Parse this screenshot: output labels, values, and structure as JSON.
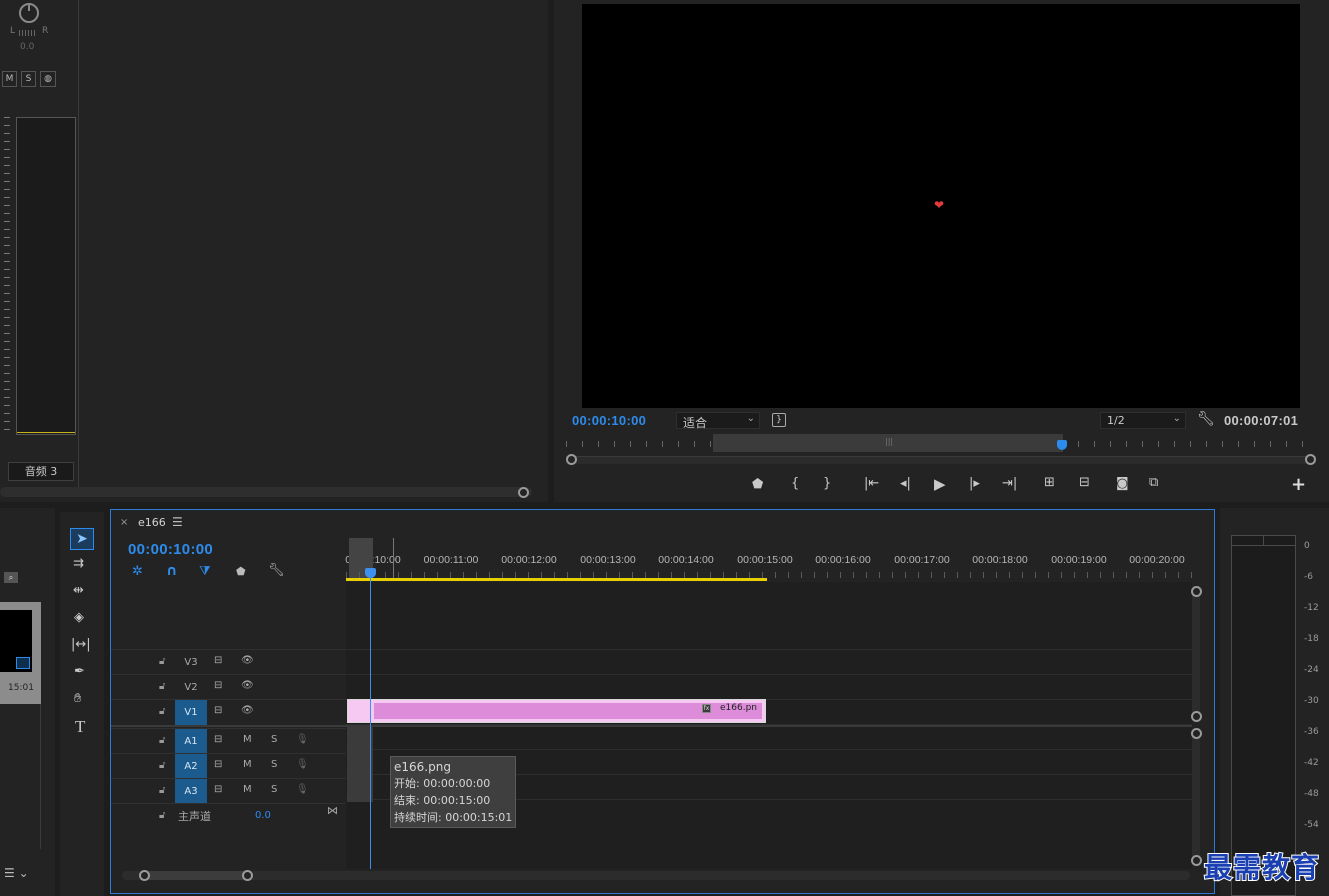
{
  "audio_mixer": {
    "pan_left": "L",
    "pan_right": "R",
    "pan_value": "0.0",
    "mute": "M",
    "solo": "S",
    "track_label": "音频 3"
  },
  "program_monitor": {
    "timecode_current": "00:00:10:00",
    "zoom_select": "适合",
    "resolution_select": "1/2",
    "timecode_duration": "00:00:07:01",
    "add_button": "+"
  },
  "project_panel": {
    "thumb_duration": "15:01"
  },
  "timeline": {
    "sequence_name": "e166",
    "timecode": "00:00:10:00",
    "ruler_labels": [
      "00:00:10:00",
      "00:00:11:00",
      "00:00:12:00",
      "00:00:13:00",
      "00:00:14:00",
      "00:00:15:00",
      "00:00:16:00",
      "00:00:17:00",
      "00:00:18:00",
      "00:00:19:00",
      "00:00:20:00"
    ],
    "video_tracks": [
      "V3",
      "V2",
      "V1"
    ],
    "audio_tracks": [
      "A1",
      "A2",
      "A3"
    ],
    "track_mute": "M",
    "track_solo": "S",
    "master_label": "主声道",
    "master_value": "0.0",
    "clip_name": "e166.pn",
    "clip_fx": "fx",
    "tooltip": {
      "title": "e166.png",
      "start": "开始: 00:00:00:00",
      "end": "结束: 00:00:15:00",
      "duration": "持续时间: 00:00:15:01"
    }
  },
  "audio_meter": {
    "ticks": [
      "0",
      "-6",
      "-12",
      "-18",
      "-24",
      "-30",
      "-36",
      "-42",
      "-48",
      "-54"
    ]
  },
  "watermark": "最需教育"
}
